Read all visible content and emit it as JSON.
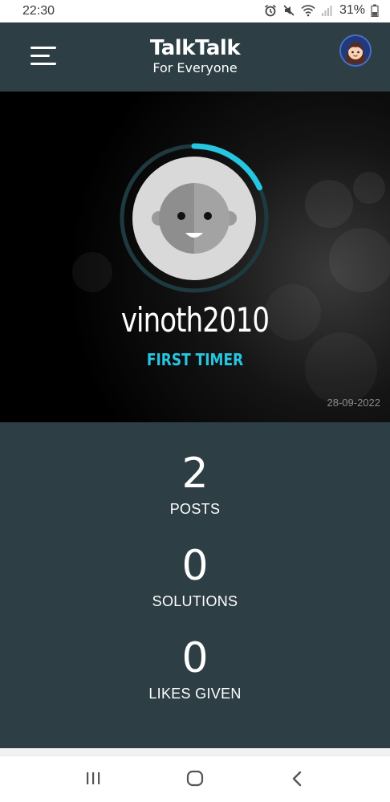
{
  "status_bar": {
    "time": "22:30",
    "battery": "31%",
    "icons": [
      "alarm-icon",
      "mute-icon",
      "wifi-icon",
      "signal-icon",
      "battery-icon"
    ]
  },
  "header": {
    "logo_main": "TalkTalk",
    "logo_sub": "For Everyone",
    "menu_icon": "hamburger-icon",
    "avatar_icon": "user-avatar"
  },
  "profile": {
    "username": "vinoth2010",
    "rank": "FIRST TIMER",
    "date": "28-09-2022",
    "rank_progress": 0.18,
    "accent_color": "#26c6e0"
  },
  "stats": [
    {
      "value": "2",
      "label": "POSTS"
    },
    {
      "value": "0",
      "label": "SOLUTIONS"
    },
    {
      "value": "0",
      "label": "LIKES GIVEN"
    }
  ],
  "nav": {
    "icons": [
      "recent-apps-icon",
      "home-icon",
      "back-icon"
    ]
  },
  "colors": {
    "header_bg": "#2e3e45",
    "stats_bg": "#2e3e45",
    "accent": "#26c6e0"
  }
}
